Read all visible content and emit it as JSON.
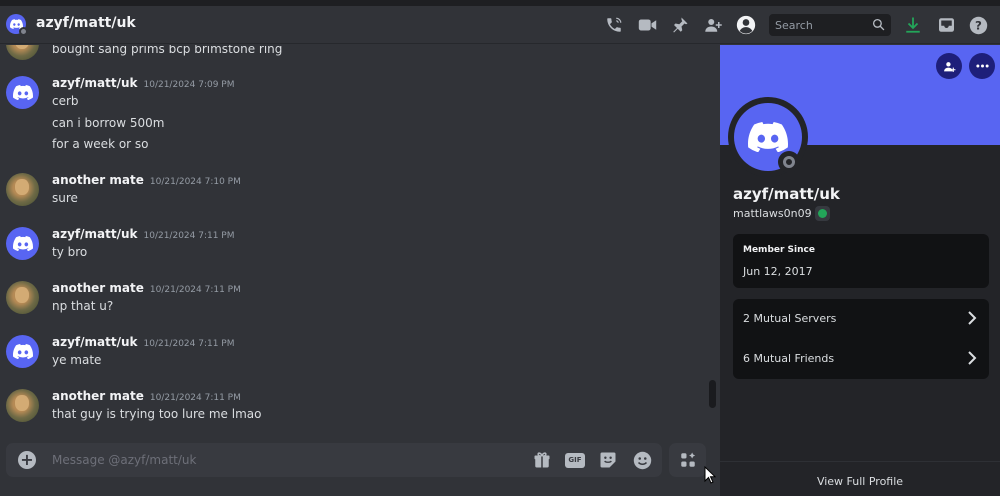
{
  "header": {
    "title": "azyf/matt/uk",
    "search_placeholder": "Search",
    "icons": [
      "voice-call-icon",
      "video-call-icon",
      "pinned-icon",
      "add-friends-icon",
      "profile-toggle-icon",
      "search-icon",
      "download-icon",
      "inbox-icon",
      "help-icon"
    ]
  },
  "colors": {
    "accent": "#5865f2",
    "background": "#313338",
    "panel": "#232428",
    "online_green": "#23a559"
  },
  "chat": {
    "partial_top": "bought sang prims bcp brimstone ring",
    "groups": [
      {
        "author": "azyf/matt/uk",
        "timestamp": "10/21/2024 7:09 PM",
        "avatar": "discord",
        "lines": [
          "cerb",
          "can i borrow 500m",
          "for a week or so"
        ]
      },
      {
        "author": "another mate",
        "timestamp": "10/21/2024 7:10 PM",
        "avatar": "cat",
        "lines": [
          "sure"
        ]
      },
      {
        "author": "azyf/matt/uk",
        "timestamp": "10/21/2024 7:11 PM",
        "avatar": "discord",
        "lines": [
          "ty bro"
        ]
      },
      {
        "author": "another mate",
        "timestamp": "10/21/2024 7:11 PM",
        "avatar": "cat",
        "lines": [
          "np that u?"
        ]
      },
      {
        "author": "azyf/matt/uk",
        "timestamp": "10/21/2024 7:11 PM",
        "avatar": "discord",
        "lines": [
          "ye mate"
        ]
      },
      {
        "author": "another mate",
        "timestamp": "10/21/2024 7:11 PM",
        "avatar": "cat",
        "lines": [
          "that guy is trying too lure me lmao"
        ]
      }
    ]
  },
  "composer": {
    "placeholder": "Message @azyf/matt/uk",
    "gif_label": "GIF"
  },
  "profile": {
    "display_name": "azyf/matt/uk",
    "username": "mattlaws0n09",
    "member_since_label": "Member Since",
    "member_since_value": "Jun 12, 2017",
    "mutual_servers": "2 Mutual Servers",
    "mutual_friends": "6 Mutual Friends",
    "view_full_profile": "View Full Profile"
  }
}
